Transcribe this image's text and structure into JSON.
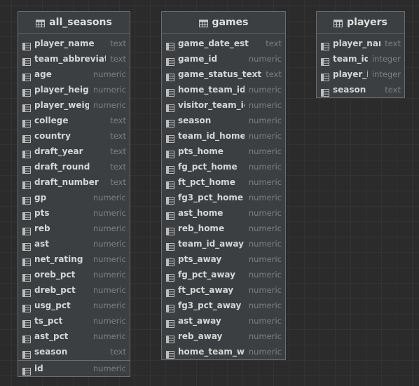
{
  "diagram": {
    "tables": [
      {
        "name": "all_seasons",
        "columns": [
          {
            "name": "player_name",
            "type": "text"
          },
          {
            "name": "team_abbreviation",
            "type": "text"
          },
          {
            "name": "age",
            "type": "numeric"
          },
          {
            "name": "player_height",
            "type": "numeric"
          },
          {
            "name": "player_weight",
            "type": "numeric"
          },
          {
            "name": "college",
            "type": "text"
          },
          {
            "name": "country",
            "type": "text"
          },
          {
            "name": "draft_year",
            "type": "text"
          },
          {
            "name": "draft_round",
            "type": "text"
          },
          {
            "name": "draft_number",
            "type": "text"
          },
          {
            "name": "gp",
            "type": "numeric"
          },
          {
            "name": "pts",
            "type": "numeric"
          },
          {
            "name": "reb",
            "type": "numeric"
          },
          {
            "name": "ast",
            "type": "numeric"
          },
          {
            "name": "net_rating",
            "type": "numeric"
          },
          {
            "name": "oreb_pct",
            "type": "numeric"
          },
          {
            "name": "dreb_pct",
            "type": "numeric"
          },
          {
            "name": "usg_pct",
            "type": "numeric"
          },
          {
            "name": "ts_pct",
            "type": "numeric"
          },
          {
            "name": "ast_pct",
            "type": "numeric"
          },
          {
            "name": "season",
            "type": "text"
          }
        ],
        "footer_columns": [
          {
            "name": "id",
            "type": "numeric"
          }
        ]
      },
      {
        "name": "games",
        "columns": [
          {
            "name": "game_date_est",
            "type": "text"
          },
          {
            "name": "game_id",
            "type": "numeric"
          },
          {
            "name": "game_status_text",
            "type": "text"
          },
          {
            "name": "home_team_id",
            "type": "numeric"
          },
          {
            "name": "visitor_team_id",
            "type": "numeric"
          },
          {
            "name": "season",
            "type": "numeric"
          },
          {
            "name": "team_id_home",
            "type": "numeric"
          },
          {
            "name": "pts_home",
            "type": "numeric"
          },
          {
            "name": "fg_pct_home",
            "type": "numeric"
          },
          {
            "name": "ft_pct_home",
            "type": "numeric"
          },
          {
            "name": "fg3_pct_home",
            "type": "numeric"
          },
          {
            "name": "ast_home",
            "type": "numeric"
          },
          {
            "name": "reb_home",
            "type": "numeric"
          },
          {
            "name": "team_id_away",
            "type": "numeric"
          },
          {
            "name": "pts_away",
            "type": "numeric"
          },
          {
            "name": "fg_pct_away",
            "type": "numeric"
          },
          {
            "name": "ft_pct_away",
            "type": "numeric"
          },
          {
            "name": "fg3_pct_away",
            "type": "numeric"
          },
          {
            "name": "ast_away",
            "type": "numeric"
          },
          {
            "name": "reb_away",
            "type": "numeric"
          },
          {
            "name": "home_team_wins",
            "type": "numeric"
          }
        ],
        "footer_columns": []
      },
      {
        "name": "players",
        "columns": [
          {
            "name": "player_name",
            "type": "text"
          },
          {
            "name": "team_id",
            "type": "integer"
          },
          {
            "name": "player_id",
            "type": "integer"
          },
          {
            "name": "season",
            "type": "text"
          }
        ],
        "footer_columns": []
      }
    ]
  }
}
